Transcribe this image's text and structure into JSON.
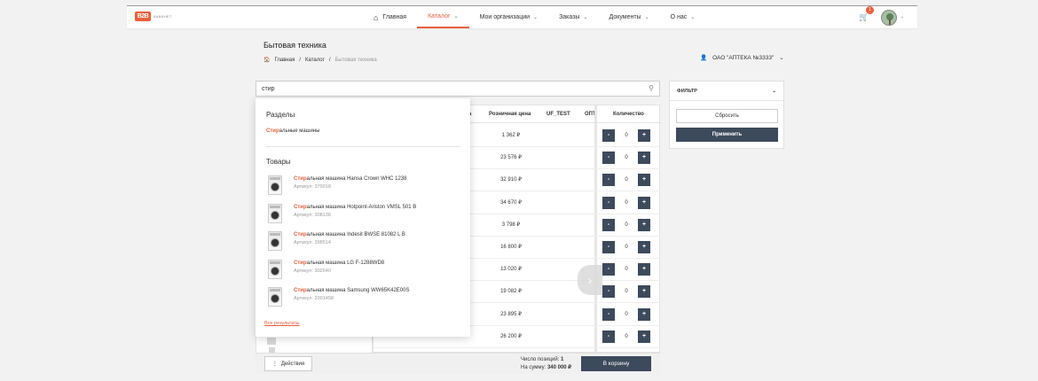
{
  "header": {
    "logo_text": "B2B",
    "logo_sub": "КАБИНЕТ",
    "nav": [
      {
        "label": "Главная"
      },
      {
        "label": "Каталог"
      },
      {
        "label": "Мои организации"
      },
      {
        "label": "Заказы"
      },
      {
        "label": "Документы"
      },
      {
        "label": "О нас"
      }
    ],
    "cart_count": "1"
  },
  "page": {
    "title": "Бытовая техника",
    "breadcrumb": [
      "Главная",
      "Каталог",
      "Бытовая техника"
    ],
    "organization": "ОАО \"АПТЕКА №3333\""
  },
  "search": {
    "value": "стир",
    "placeholder": ""
  },
  "table": {
    "columns": [
      "Розничная цена",
      "UF_TEST",
      "ОПТ",
      "Количество"
    ],
    "col_prefix": "а",
    "rows": [
      {
        "price": "1 362 ₽",
        "qty": "0"
      },
      {
        "price": "23 576 ₽",
        "qty": "0"
      },
      {
        "price": "32 910 ₽",
        "qty": "0"
      },
      {
        "price": "34 670 ₽",
        "qty": "0"
      },
      {
        "price": "3 798 ₽",
        "qty": "0"
      },
      {
        "price": "16 800 ₽",
        "qty": "0"
      },
      {
        "price": "13 020 ₽",
        "qty": "0"
      },
      {
        "price": "19 082 ₽",
        "qty": "0"
      },
      {
        "price": "23 895 ₽",
        "qty": "0"
      },
      {
        "price": "26 200 ₽",
        "qty": "0"
      }
    ],
    "minus": "-",
    "plus": "+"
  },
  "bottom": {
    "actions_label": "Действия",
    "positions_label": "Число позиций:",
    "positions_value": "1",
    "sum_label": "На сумму:",
    "sum_value": "340 000 ₽",
    "to_cart_label": "В корзину"
  },
  "filter": {
    "title": "ФИЛЬТР",
    "reset_label": "Сбросить",
    "apply_label": "Применить"
  },
  "dropdown": {
    "sections_title": "Разделы",
    "section_hl": "Стир",
    "section_rest": "альные машины",
    "products_title": "Товары",
    "products": [
      {
        "hl": "Стир",
        "rest": "альная машина Hansa Crown WHC 1238",
        "article": "Артикул: 379018"
      },
      {
        "hl": "Стир",
        "rest": "альная машина Hotpoint-Ariston VMSL 501 B",
        "article": "Артикул: 308136"
      },
      {
        "hl": "Стир",
        "rest": "альная машина Indesit BWSE 81082 L B",
        "article": "Артикул: 398514"
      },
      {
        "hl": "Стир",
        "rest": "альная машина LG F-1288WD8",
        "article": "Артикул: 302640"
      },
      {
        "hl": "Стир",
        "rest": "альная машина Samsung WW65K42E00S",
        "article": "Артикул: 2001458"
      }
    ],
    "all_results": "Все результаты"
  },
  "colors": {
    "accent": "#e8603c",
    "dark": "#3d4a5c"
  }
}
